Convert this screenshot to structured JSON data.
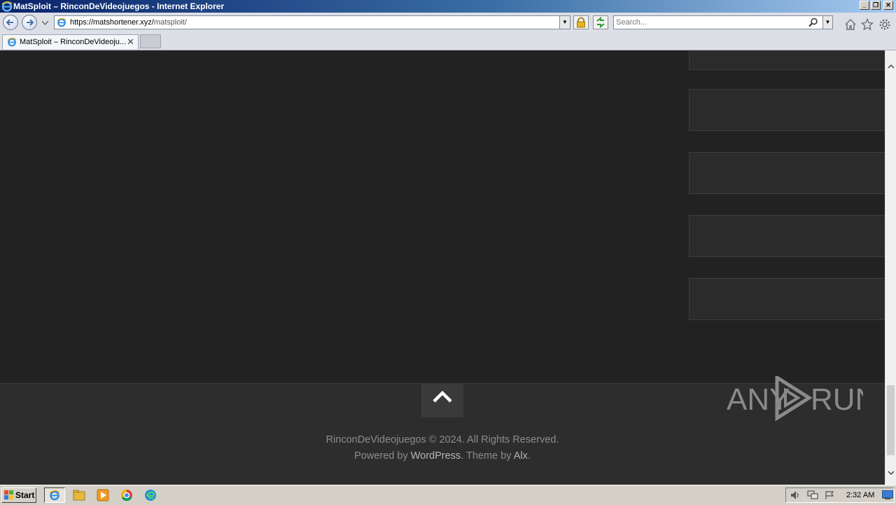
{
  "window": {
    "title": "MatSploit – RinconDeVideojuegos - Internet Explorer",
    "controls": {
      "minimize": "_",
      "restore": "❐",
      "close": "✕"
    }
  },
  "navbar": {
    "url_host": "https://matshortener.xyz/",
    "url_path": "matsploit/",
    "search_placeholder": "Search..."
  },
  "tabs": [
    {
      "label": "MatSploit – RinconDeVideoju...",
      "active": true
    }
  ],
  "footer": {
    "copyright": "RinconDeVideojuegos © 2024. All Rights Reserved.",
    "powered_prefix": "Powered by ",
    "powered_link": "WordPress",
    "theme_prefix": ". Theme by ",
    "theme_link": "Alx",
    "theme_suffix": "."
  },
  "watermark": {
    "text": "ANY RUN"
  },
  "taskbar": {
    "start_label": "Start",
    "clock": "2:32 AM"
  },
  "colors": {
    "page_bg": "#222222",
    "footer_bg": "#2d2d2d",
    "widget_bg": "#2b2b2b",
    "taskbar_bg": "#d4d0c8"
  }
}
